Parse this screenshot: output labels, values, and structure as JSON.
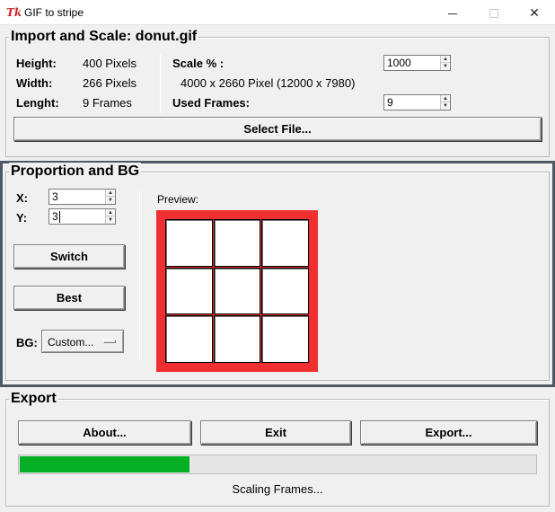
{
  "window": {
    "icon": "tk-feather-icon",
    "icon_text": "Tk",
    "title": "GIF to stripe",
    "controls": {
      "minimize": "minimize-icon",
      "maximize": "maximize-icon",
      "close": "close-icon",
      "close_glyph": "✕"
    }
  },
  "import_scale": {
    "legend": "Import and Scale: donut.gif",
    "height_label": "Height:",
    "height_value": "400 Pixels",
    "width_label": "Width:",
    "width_value": "266 Pixels",
    "length_label": "Lenght:",
    "length_value": "9 Frames",
    "scale_label": "Scale % :",
    "scale_value": "1000",
    "scaled_size": "4000 x 2660 Pixel (12000 x 7980)",
    "used_frames_label": "Used Frames:",
    "used_frames_value": "9",
    "select_file_button": "Select File..."
  },
  "proportion": {
    "legend": "Proportion and BG",
    "x_label": "X:",
    "x_value": "3",
    "y_label": "Y:",
    "y_value": "3",
    "switch_button": "Switch",
    "best_button": "Best",
    "bg_label": "BG:",
    "bg_value": "Custom...",
    "preview_label": "Preview:",
    "preview_grid": {
      "columns": 3,
      "rows": 3
    },
    "bg_color": "#f03030"
  },
  "export": {
    "legend": "Export",
    "about_button": "About...",
    "exit_button": "Exit",
    "export_button": "Export...",
    "progress_fraction": 0.33,
    "progress_color": "#06b025",
    "status_text": "Scaling Frames..."
  }
}
